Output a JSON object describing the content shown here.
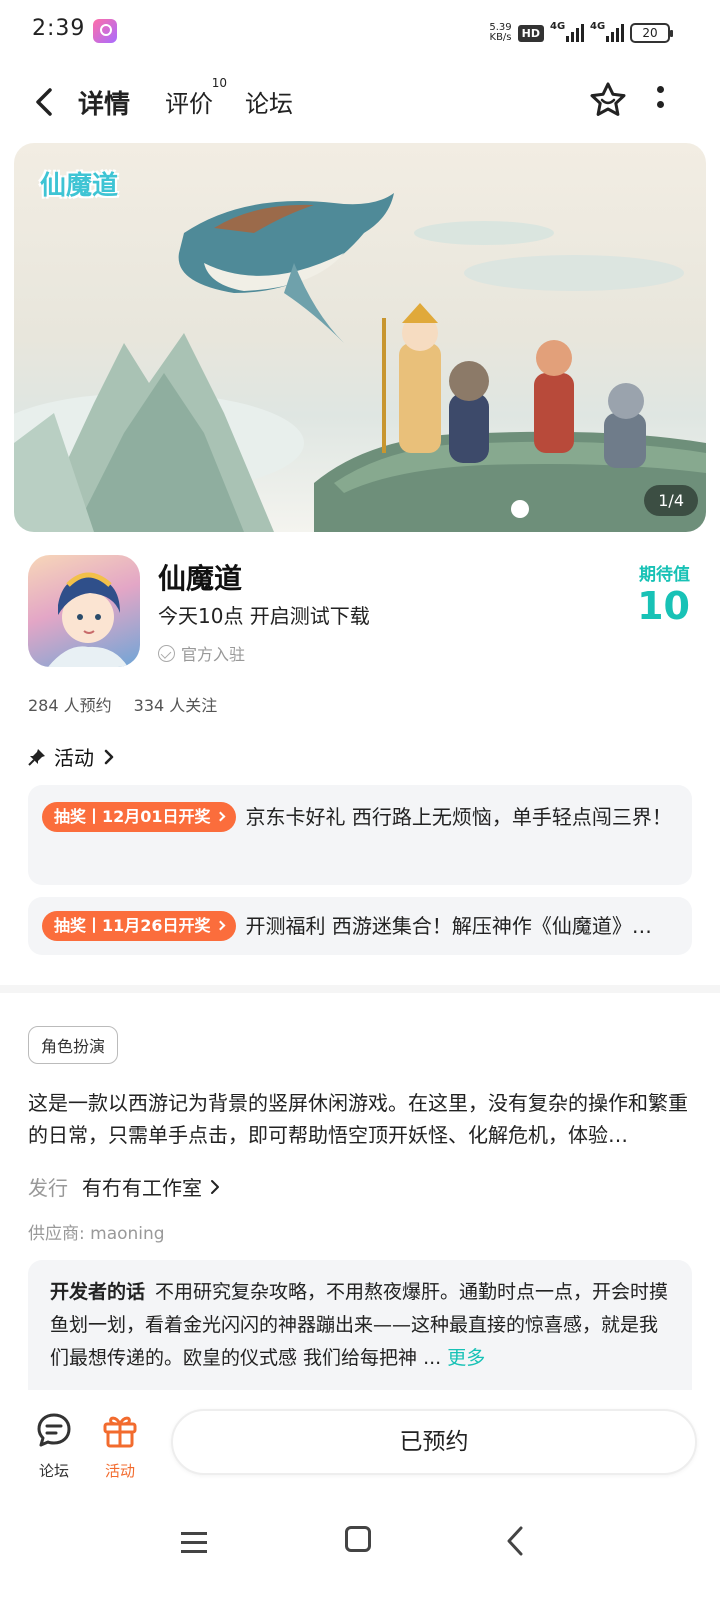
{
  "status_bar": {
    "time": "2:39",
    "net_speed_value": "5.39",
    "net_speed_unit": "KB/s",
    "hd_badge": "HD",
    "signal_1_label": "4G",
    "signal_2_label": "4G",
    "battery": "20"
  },
  "nav": {
    "tabs": [
      {
        "label": "详情",
        "active": true
      },
      {
        "label": "评价",
        "badge": "10"
      },
      {
        "label": "论坛"
      }
    ]
  },
  "banner": {
    "logo_text": "仙魔道",
    "page_indicator": "1/4"
  },
  "app": {
    "name": "仙魔道",
    "subtitle": "今天10点 开启测试下载",
    "official_label": "官方入驻",
    "expect_label": "期待值",
    "expect_value": "10",
    "reservations": "284 人预约",
    "followers": "334 人关注"
  },
  "activity": {
    "header": "活动",
    "cards": [
      {
        "tag": "抽奖丨12月01日开奖",
        "text": "京东卡好礼 西行路上无烦恼，单手轻点闯三界！"
      },
      {
        "tag": "抽奖丨11月26日开奖",
        "text": "开测福利 西游迷集合！解压神作《仙魔道》…"
      }
    ]
  },
  "details": {
    "genre_tag": "角色扮演",
    "description": "这是一款以西游记为背景的竖屏休闲游戏。在这里，没有复杂的操作和繁重的日常，只需单手点击，即可帮助悟空顶开妖怪、化解危机，体验…",
    "publisher_label": "发行",
    "publisher_name": "有冇有工作室",
    "supplier": "供应商: maoning",
    "dev_heading": "开发者的话",
    "dev_text": "不用研究复杂攻略，不用熬夜爆肝。通勤时点一点，开会时摸鱼划一划，看着金光闪闪的神器蹦出来——这种最直接的惊喜感，就是我们最想传递的。欧皇的仪式感 我们给每把神 ...",
    "dev_more": "更多"
  },
  "bottom_bar": {
    "forum_label": "论坛",
    "activity_label": "活动",
    "reserve_button": "已预约"
  },
  "colors": {
    "accent": "#18c2b6",
    "orange": "#fb6d3c",
    "card_bg": "#f4f5f7"
  },
  "icons": [
    "back-icon",
    "star-icon",
    "more-vertical-icon",
    "verified-check-icon",
    "pin-icon",
    "chevron-right-icon",
    "forum-chat-icon",
    "gift-icon",
    "menu-icon",
    "home-icon",
    "back-nav-icon"
  ]
}
